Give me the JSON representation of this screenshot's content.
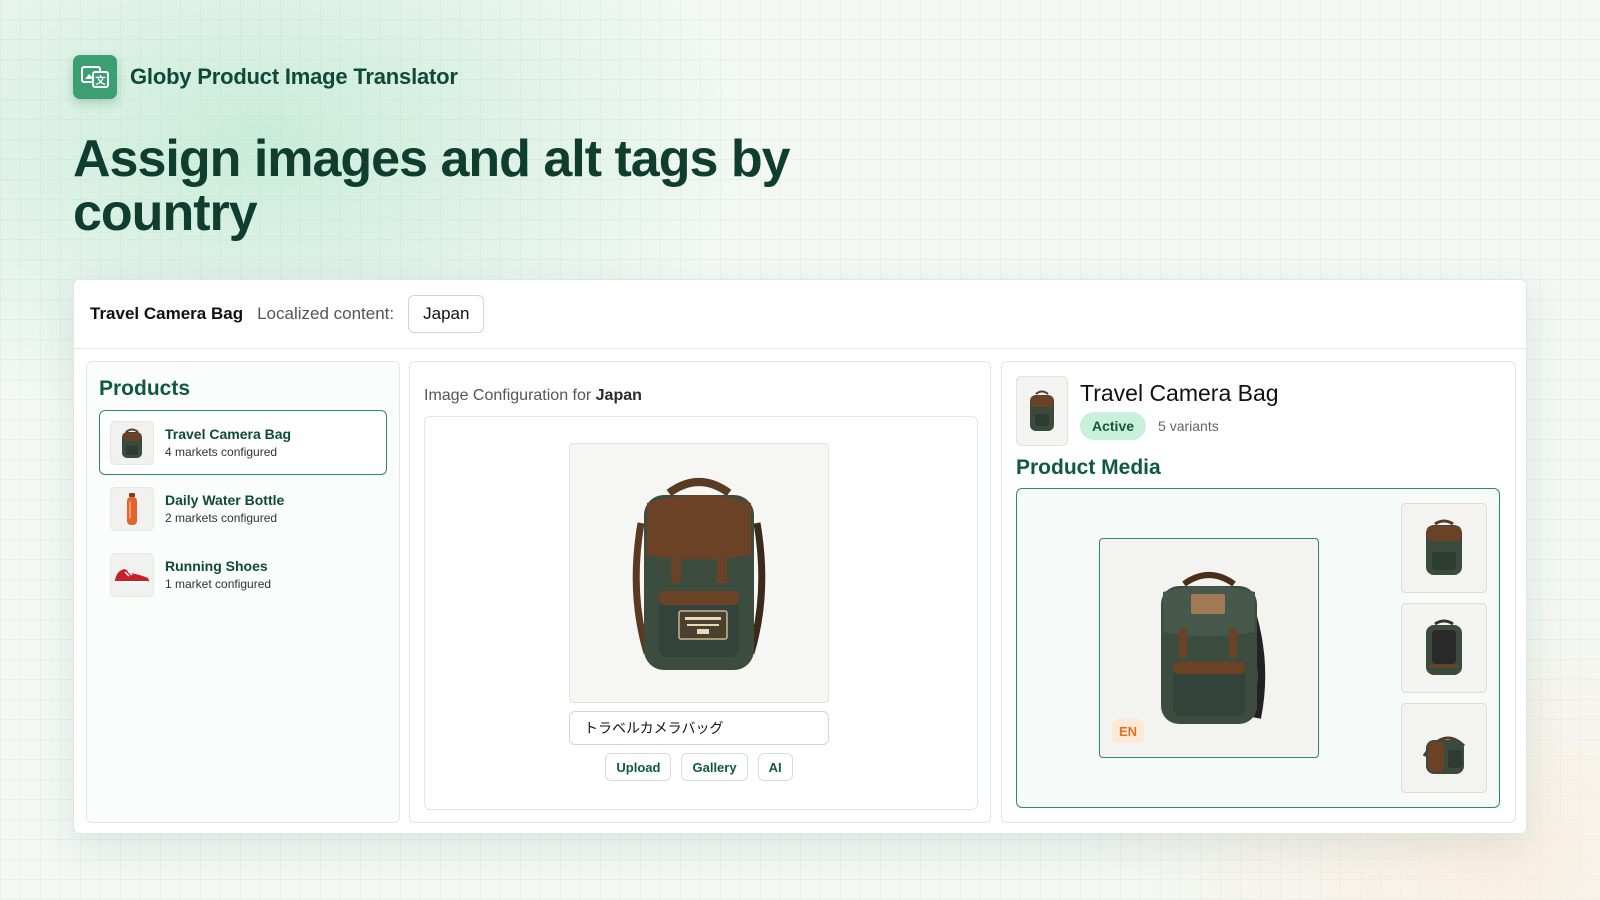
{
  "brand": {
    "name": "Globy Product Image Translator"
  },
  "headline": "Assign images and alt tags by country",
  "topbar": {
    "product": "Travel Camera Bag",
    "localized_label": "Localized content:",
    "country": "Japan"
  },
  "products_panel": {
    "title": "Products",
    "items": [
      {
        "name": "Travel Camera Bag",
        "sub": "4 markets configured",
        "selected": true
      },
      {
        "name": "Daily Water Bottle",
        "sub": "2 markets configured",
        "selected": false
      },
      {
        "name": "Running Shoes",
        "sub": "1 market configured",
        "selected": false
      }
    ]
  },
  "image_config": {
    "heading_prefix": "Image Configuration for",
    "heading_country": "Japan",
    "alt_text": "トラベルカメラバッグ",
    "buttons": {
      "upload": "Upload",
      "gallery": "Gallery",
      "ai": "AI"
    }
  },
  "product_detail": {
    "title": "Travel Camera Bag",
    "status": "Active",
    "variants": "5 variants",
    "media_title": "Product Media",
    "language_badge": "EN"
  },
  "colors": {
    "brand_green": "#3c9e73",
    "dark_green": "#0f3d2e",
    "accent_green": "#2f8a62",
    "active_badge_bg": "#c9f0da",
    "lang_badge_fg": "#e0731e"
  }
}
